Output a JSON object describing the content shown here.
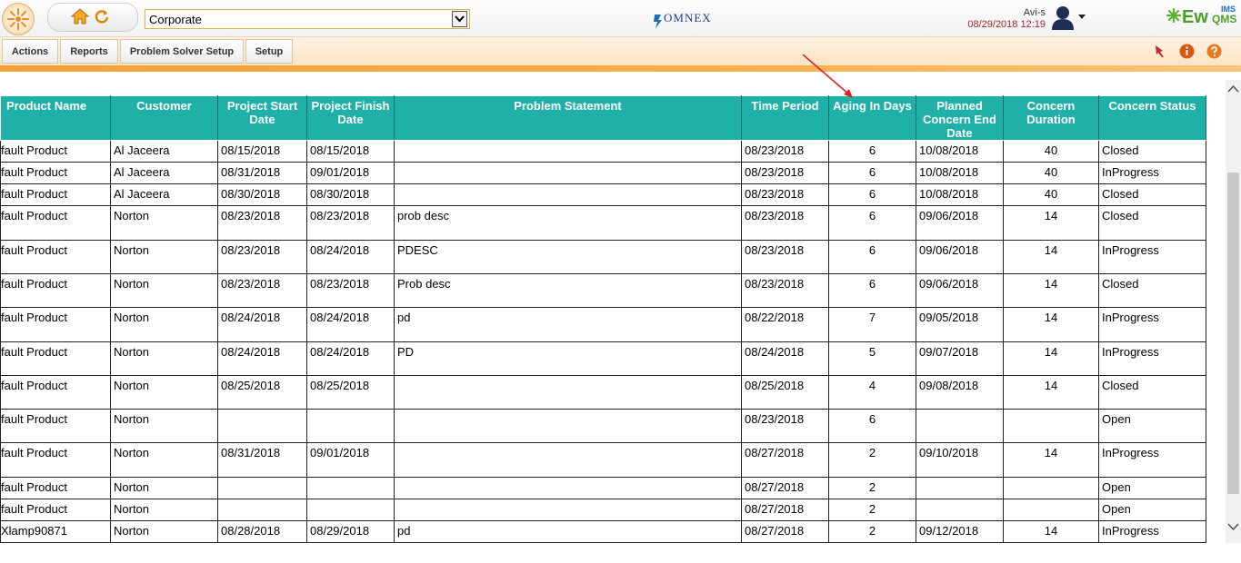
{
  "header": {
    "company_select_value": "Corporate",
    "user_name": "Avi-s",
    "datetime": "08/29/2018 12:19",
    "omnex_logo_text": "OMNEX",
    "brand_logo_text": "Ew",
    "brand_logo_suffix": "QMS",
    "brand_logo_sup": "IMS"
  },
  "nav": {
    "tabs": [
      "Actions",
      "Reports",
      "Problem Solver Setup",
      "Setup"
    ],
    "icons": [
      "pin-icon",
      "info-icon",
      "help-icon"
    ]
  },
  "colors": {
    "header_teal": "#1fb1a8",
    "accent_orange": "#f4a13a",
    "select_border": "#e3b24d"
  },
  "table": {
    "columns": [
      "Product Name",
      "Customer",
      "Project Start Date",
      "Project Finish Date",
      "Problem Statement",
      "Time Period",
      "Aging In Days",
      "Planned Concern End Date",
      "Concern Duration",
      "Concern Status"
    ],
    "rows": [
      [
        "fault Product",
        "Al Jaceera",
        "08/15/2018",
        "08/15/2018",
        "",
        "08/23/2018",
        "6",
        "10/08/2018",
        "40",
        "Closed"
      ],
      [
        "fault Product",
        "Al Jaceera",
        "08/31/2018",
        "09/01/2018",
        "",
        "08/23/2018",
        "6",
        "10/08/2018",
        "40",
        "InProgress"
      ],
      [
        "fault Product",
        "Al Jaceera",
        "08/30/2018",
        "08/30/2018",
        "",
        "08/23/2018",
        "6",
        "10/08/2018",
        "40",
        "Closed"
      ],
      [
        "fault Product",
        "Norton",
        "08/23/2018",
        "08/23/2018",
        "prob desc",
        "08/23/2018",
        "6",
        "09/06/2018",
        "14",
        "Closed"
      ],
      [
        "fault Product",
        "Norton",
        "08/23/2018",
        "08/24/2018",
        "PDESC",
        "08/23/2018",
        "6",
        "09/06/2018",
        "14",
        "InProgress"
      ],
      [
        "fault Product",
        "Norton",
        "08/23/2018",
        "08/23/2018",
        "Prob desc",
        "08/23/2018",
        "6",
        "09/06/2018",
        "14",
        "Closed"
      ],
      [
        "fault Product",
        "Norton",
        "08/24/2018",
        "08/24/2018",
        "pd",
        "08/22/2018",
        "7",
        "09/05/2018",
        "14",
        "InProgress"
      ],
      [
        "fault Product",
        "Norton",
        "08/24/2018",
        "08/24/2018",
        "PD",
        "08/24/2018",
        "5",
        "09/07/2018",
        "14",
        "InProgress"
      ],
      [
        "fault Product",
        "Norton",
        "08/25/2018",
        "08/25/2018",
        "",
        "08/25/2018",
        "4",
        "09/08/2018",
        "14",
        "Closed"
      ],
      [
        "fault Product",
        "Norton",
        "",
        "",
        "",
        "08/23/2018",
        "6",
        "",
        "",
        "Open"
      ],
      [
        "fault Product",
        "Norton",
        "08/31/2018",
        "09/01/2018",
        "",
        "08/27/2018",
        "2",
        "09/10/2018",
        "14",
        "InProgress"
      ],
      [
        "fault Product",
        "Norton",
        "",
        "",
        "",
        "08/27/2018",
        "2",
        "",
        "",
        "Open"
      ],
      [
        "fault Product",
        "Norton",
        "",
        "",
        "",
        "08/27/2018",
        "2",
        "",
        "",
        "Open"
      ],
      [
        "Xlamp90871",
        "Norton",
        "08/28/2018",
        "08/29/2018",
        "pd",
        "08/27/2018",
        "2",
        "09/12/2018",
        "14",
        "InProgress"
      ]
    ]
  }
}
